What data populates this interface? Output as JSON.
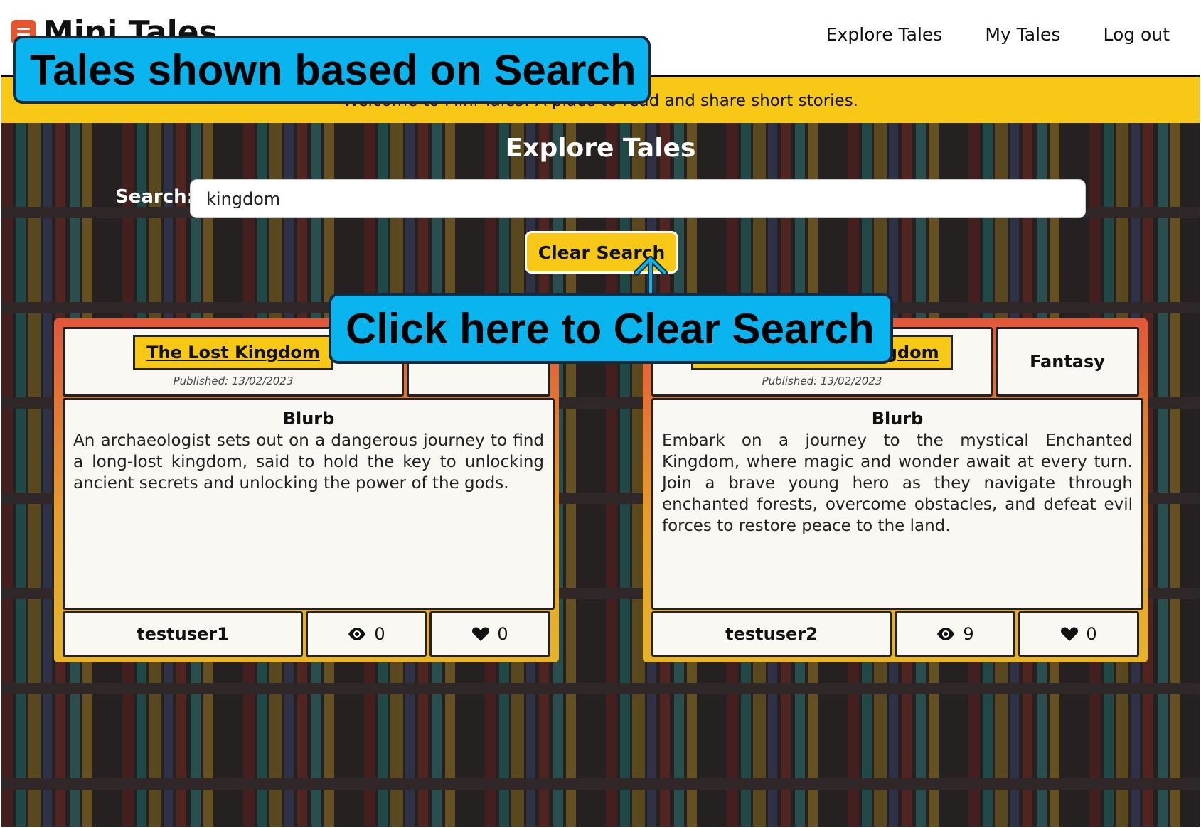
{
  "header": {
    "app_title": "Mini Tales",
    "nav": [
      "Explore Tales",
      "My Tales",
      "Log out"
    ],
    "banner": "Welcome to Mini Tales! A place to read and share short stories."
  },
  "page": {
    "title": "Explore Tales",
    "search_label": "Search:",
    "search_value": "kingdom",
    "clear_button": "Clear Search"
  },
  "tales": [
    {
      "title": "The Lost Kingdom",
      "published": "Published: 13/02/2023",
      "genre": "",
      "blurb_heading": "Blurb",
      "blurb": "An archaeologist sets out on a dangerous journey to find a long-lost kingdom, said to hold the key to unlocking ancient secrets and unlocking the power of the gods.",
      "author": "testuser1",
      "views": "0",
      "likes": "0"
    },
    {
      "title": "The Enchanted Kingdom",
      "published": "Published: 13/02/2023",
      "genre": "Fantasy",
      "blurb_heading": "Blurb",
      "blurb": "Embark on a journey to the mystical Enchanted Kingdom, where magic and wonder await at every turn. Join a brave young hero as they navigate through enchanted forests, overcome obstacles, and defeat evil forces to restore peace to the land.",
      "author": "testuser2",
      "views": "9",
      "likes": "0"
    }
  ],
  "annotations": {
    "callout_search": "Tales shown based on Search",
    "callout_clear": "Click here to Clear Search"
  },
  "icons": {
    "menu": "hamburger-icon",
    "views": "eye-icon",
    "likes": "heart-icon"
  },
  "colors": {
    "accent": "#f7c816",
    "callout": "#0ab4ee",
    "card_top": "#e2563a"
  }
}
